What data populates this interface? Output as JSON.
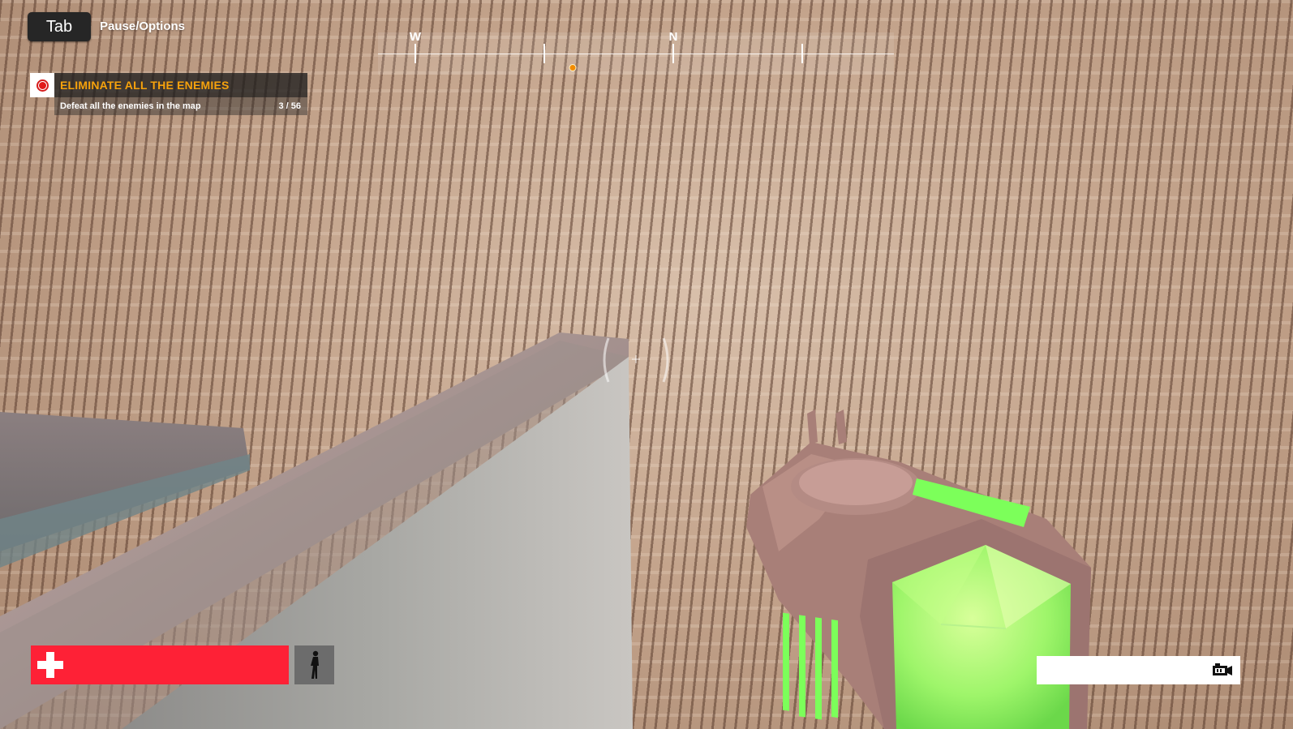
{
  "hud": {
    "tab_key": "Tab",
    "tab_label": "Pause/Options"
  },
  "objective": {
    "icon": "target-icon",
    "title": "ELIMINATE ALL THE ENEMIES",
    "description": "Defeat all the enemies in the map",
    "progress": "3 / 56",
    "progress_fraction": 0.0536
  },
  "compass": {
    "headings": [
      "W",
      "N"
    ],
    "marker_color": "#f28b00"
  },
  "health": {
    "icon": "health-cross-icon",
    "value_fraction": 1.0,
    "color": "#fe2136"
  },
  "stance": {
    "icon": "standing-person-icon"
  },
  "weapon": {
    "icon": "camera-weapon-icon"
  },
  "colors": {
    "objective_title": "#f6a20c",
    "weapon_glow": "#7cff5a"
  }
}
